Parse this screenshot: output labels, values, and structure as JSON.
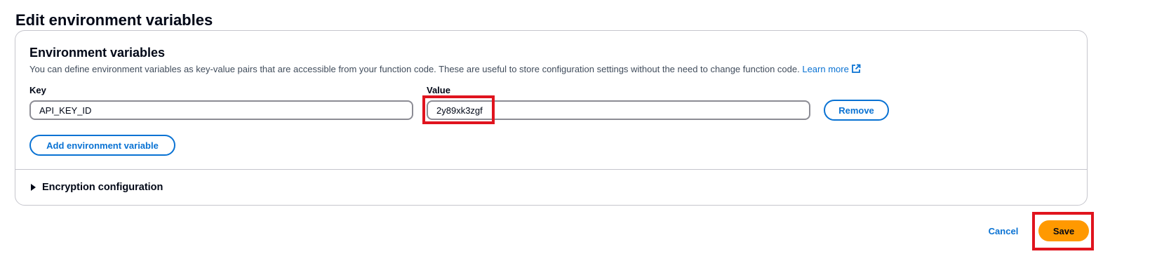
{
  "page": {
    "title": "Edit environment variables"
  },
  "panel": {
    "title": "Environment variables",
    "description": "You can define environment variables as key-value pairs that are accessible from your function code. These are useful to store configuration settings without the need to change function code.",
    "learn_more_label": "Learn more",
    "learn_more_icon": "external-link-icon"
  },
  "variables": {
    "key_label": "Key",
    "value_label": "Value",
    "rows": [
      {
        "key": "API_KEY_ID",
        "value": "2y89xk3zgf",
        "remove_label": "Remove"
      }
    ],
    "add_label": "Add environment variable"
  },
  "encryption": {
    "label": "Encryption configuration",
    "expanded": false,
    "icon": "caret-right-icon"
  },
  "actions": {
    "cancel_label": "Cancel",
    "save_label": "Save"
  },
  "annotations": {
    "highlight_color": "#e0141e",
    "highlighted": [
      "value-input",
      "save-button"
    ]
  },
  "colors": {
    "link": "#0972d3",
    "primary_button": "#ff9900",
    "text": "#000716",
    "border": "#c6c6cd",
    "input_border": "#8c8c94"
  }
}
